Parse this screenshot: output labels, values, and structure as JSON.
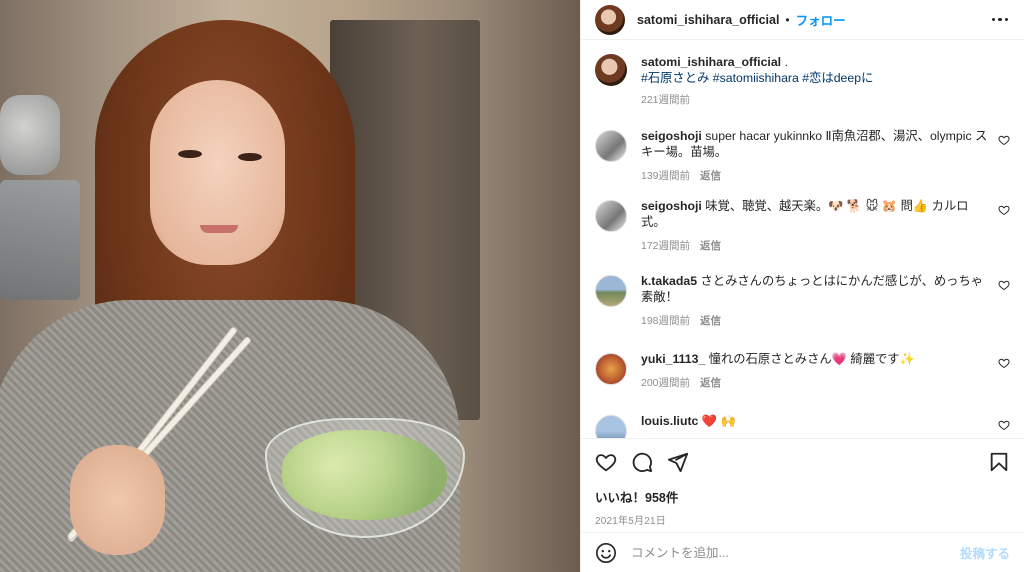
{
  "post": {
    "username": "satomi_ishihara_official",
    "dot": "•",
    "follow_label": "フォロー"
  },
  "caption": {
    "username": "satomi_ishihara_official",
    "text": " .",
    "hashtags": "#石原さとみ #satomiishihara #恋はdeepに",
    "time": "221週間前"
  },
  "comments": [
    {
      "username": "seigoshoji",
      "text": " super hacar yukinnko Ⅱ南魚沼郡、湯沢、olympic スキー場。苗場。",
      "time": "139週間前",
      "reply": "返信"
    },
    {
      "username": "seigoshoji",
      "text": " 味覚、聴覚、越天楽。🐶 🐕 🐭 🐹 問👍 カルロ式。",
      "time": "172週間前",
      "reply": "返信"
    },
    {
      "username": "k.takada5",
      "text": " さとみさんのちょっとはにかんだ感じが、めっちゃ素敵！",
      "time": "198週間前",
      "reply": "返信"
    },
    {
      "username": "yuki_1113_",
      "text": " 憧れの石原さとみさん💗 綺麗です✨",
      "time": "200週間前",
      "reply": "返信"
    },
    {
      "username": "louis.liutc",
      "text": " ❤️ 🙌",
      "time": "",
      "reply": ""
    }
  ],
  "likes": "いいね！958件",
  "date": "2021年5月21日",
  "add_comment": {
    "placeholder": "コメントを追加...",
    "post_label": "投稿する"
  },
  "icons": [
    "heart-icon",
    "comment-icon",
    "share-icon",
    "bookmark-icon",
    "emoji-icon",
    "more-icon"
  ],
  "colors": {
    "link": "#0095f6",
    "hashtag": "#00376b",
    "muted": "#8e8e8e",
    "text": "#262626"
  }
}
